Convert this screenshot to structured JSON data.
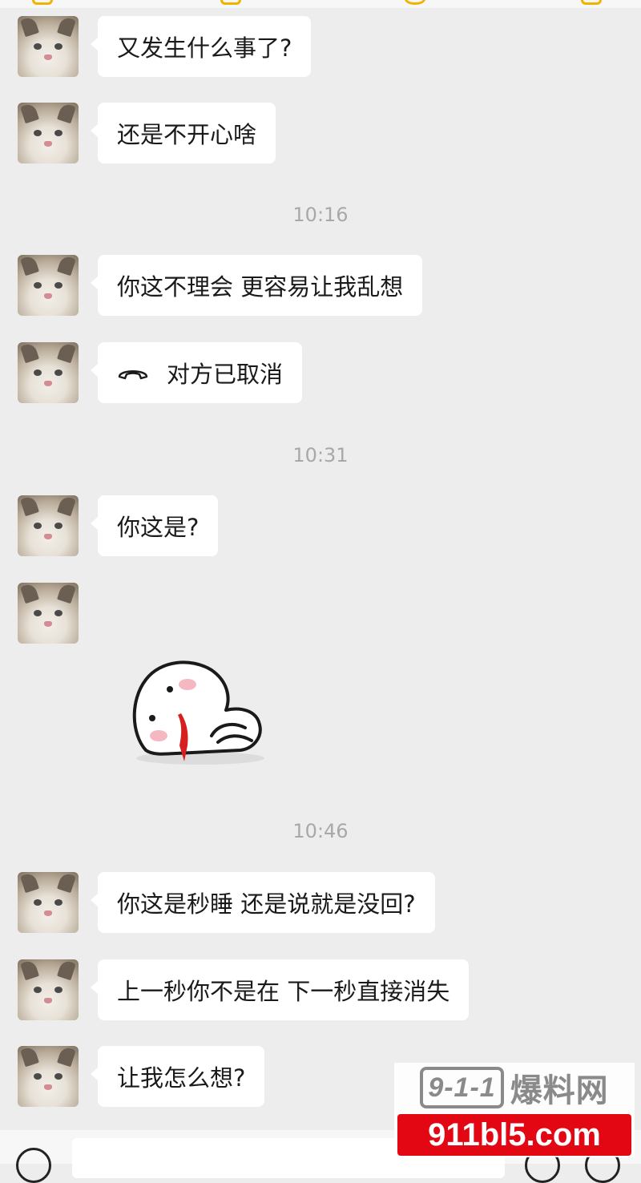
{
  "messages": [
    {
      "text": "又发生什么事了?"
    },
    {
      "text": "还是不开心啥"
    },
    {
      "text": "你这不理会 更容易让我乱想"
    },
    {
      "text": "对方已取消",
      "icon": "phone-hangup-icon"
    },
    {
      "text": "你这是?"
    },
    {
      "text": "你这是秒睡 还是说就是没回?"
    },
    {
      "text": "上一秒你不是在 下一秒直接消失"
    },
    {
      "text": "让我怎么想?"
    }
  ],
  "timestamps": [
    "10:16",
    "10:31",
    "10:46"
  ],
  "sticker": {
    "icon": "nosebleed-blob-sticker"
  },
  "watermark": {
    "brand_box": "9-1-1",
    "brand_text": "爆料网",
    "domain": "911bl5.com"
  },
  "colors": {
    "background": "#ededed",
    "bubble": "#ffffff",
    "watermark_red": "#e30613"
  }
}
